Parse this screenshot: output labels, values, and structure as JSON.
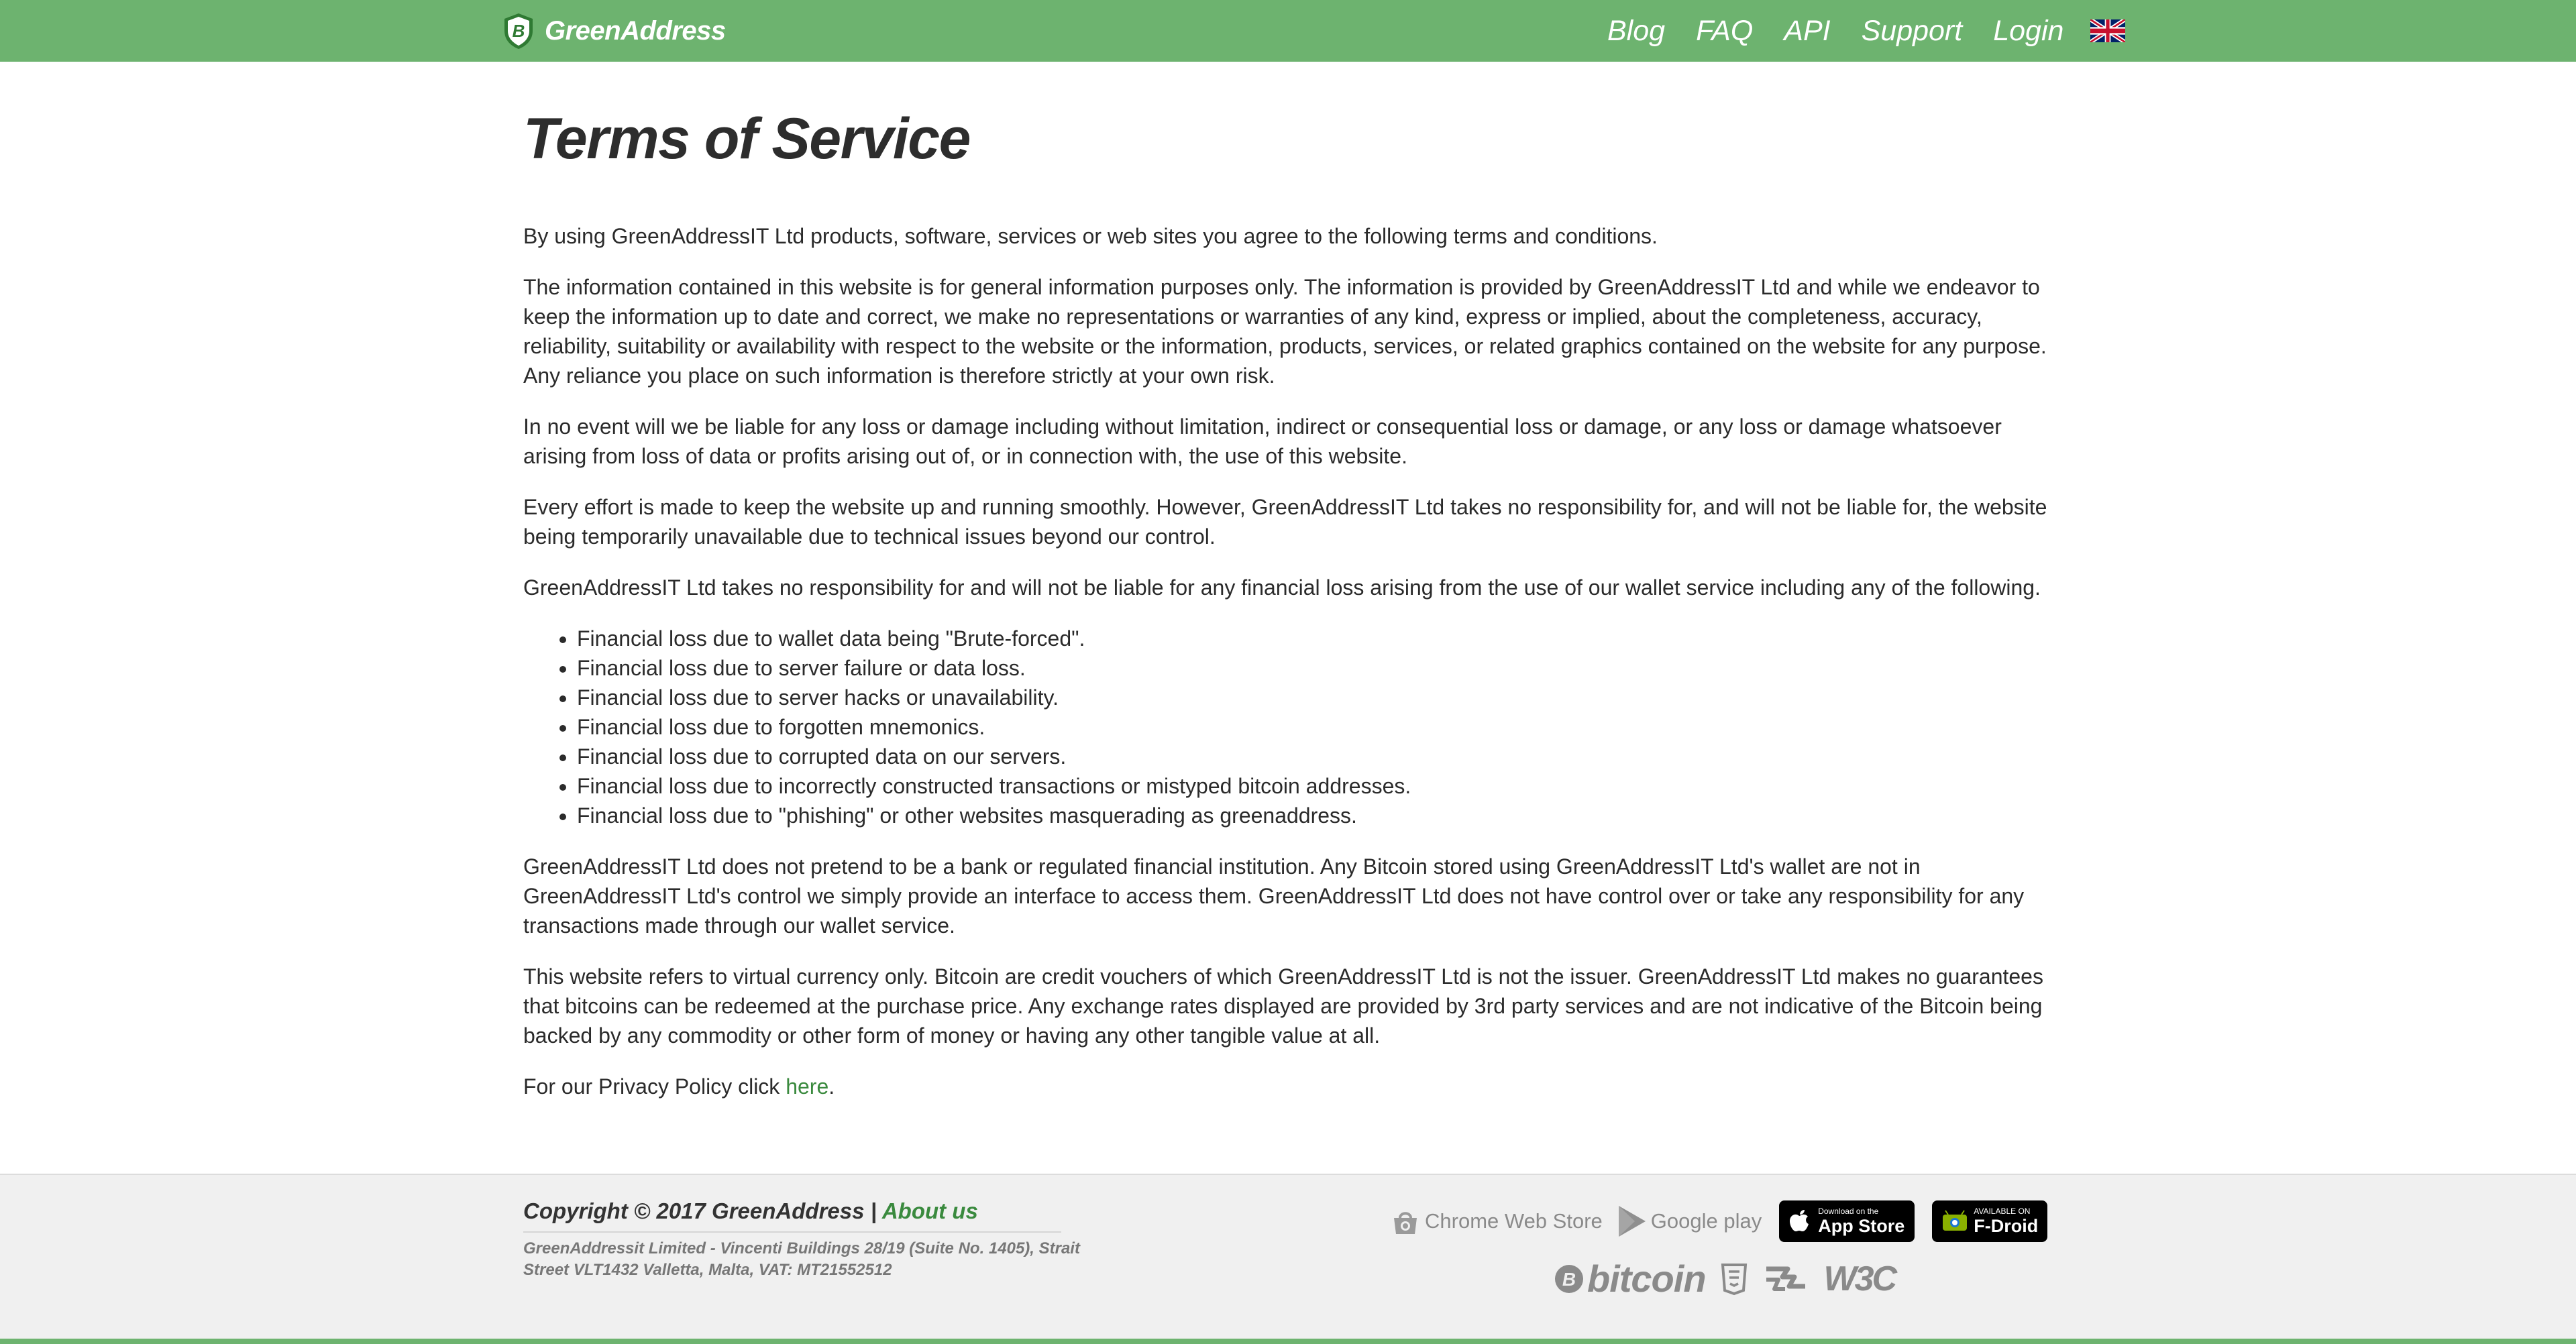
{
  "header": {
    "brand_name": "GreenAddress",
    "nav": {
      "blog": "Blog",
      "faq": "FAQ",
      "api": "API",
      "support": "Support",
      "login": "Login"
    },
    "bg_color": "#6db36f"
  },
  "page": {
    "title": "Terms of Service",
    "paragraphs": [
      "By using GreenAddressIT Ltd products, software, services or web sites you agree to the following terms and conditions.",
      "The information contained in this website is for general information purposes only. The information is provided by GreenAddressIT Ltd and while we endeavor to keep the information up to date and correct, we make no representations or warranties of any kind, express or implied, about the completeness, accuracy, reliability, suitability or availability with respect to the website or the information, products, services, or related graphics contained on the website for any purpose. Any reliance you place on such information is therefore strictly at your own risk.",
      "In no event will we be liable for any loss or damage including without limitation, indirect or consequential loss or damage, or any loss or damage whatsoever arising from loss of data or profits arising out of, or in connection with, the use of this website.",
      "Every effort is made to keep the website up and running smoothly. However, GreenAddressIT Ltd takes no responsibility for, and will not be liable for, the website being temporarily unavailable due to technical issues beyond our control.",
      "GreenAddressIT Ltd takes no responsibility for and will not be liable for any financial loss arising from the use of our wallet service including any of the following."
    ],
    "losses": [
      "Financial loss due to wallet data being \"Brute-forced\".",
      "Financial loss due to server failure or data loss.",
      "Financial loss due to server hacks or unavailability.",
      "Financial loss due to forgotten mnemonics.",
      "Financial loss due to corrupted data on our servers.",
      "Financial loss due to incorrectly constructed transactions or mistyped bitcoin addresses.",
      "Financial loss due to \"phishing\" or other websites masquerading as greenaddress."
    ],
    "paragraphs_after": [
      "GreenAddressIT Ltd does not pretend to be a bank or regulated financial institution. Any Bitcoin stored using GreenAddressIT Ltd's wallet are not in GreenAddressIT Ltd's control we simply provide an interface to access them. GreenAddressIT Ltd does not have control over or take any responsibility for any transactions made through our wallet service.",
      "This website refers to virtual currency only. Bitcoin are credit vouchers of which GreenAddressIT Ltd is not the issuer. GreenAddressIT Ltd makes no guarantees that bitcoins can be redeemed at the purchase price. Any exchange rates displayed are provided by 3rd party services and are not indicative of the Bitcoin being backed by any commodity or other form of money or having any other tangible value at all."
    ],
    "privacy": {
      "prefix": "For our Privacy Policy click ",
      "link": "here",
      "suffix": "."
    }
  },
  "footer": {
    "copyright": "Copyright © 2017 GreenAddress | ",
    "about_link": "About us",
    "address": "GreenAddressit Limited - Vincenti Buildings 28/19 (Suite No. 1405), Strait Street VLT1432 Valletta, Malta, VAT: MT21552512",
    "stores": {
      "chrome": "Chrome Web Store",
      "google": "Google play",
      "appstore_small": "Download on the",
      "appstore_big": "App Store",
      "fdroid_small": "AVAILABLE ON",
      "fdroid_big": "F-Droid"
    },
    "tech": {
      "bitcoin": "bitcoin",
      "w3c": "W3C"
    },
    "accent_color": "#3a8a3e"
  }
}
